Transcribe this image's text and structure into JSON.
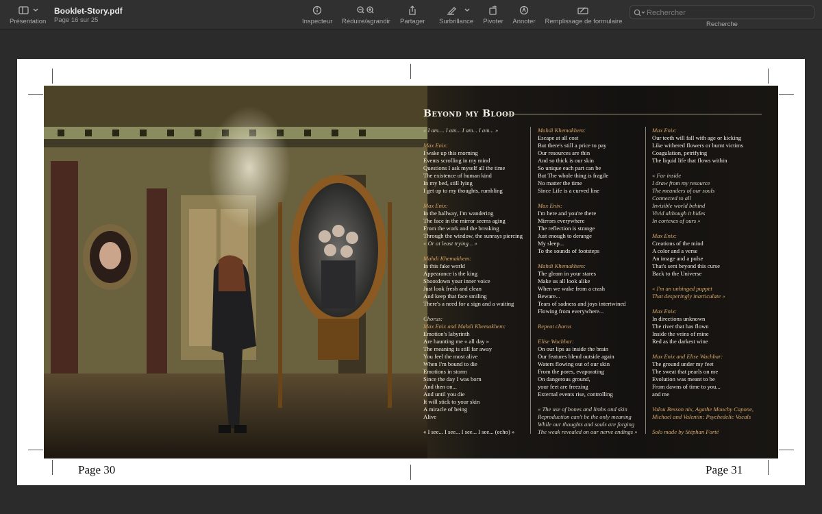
{
  "toolbar": {
    "view_label": "Présentation",
    "document_title": "Booklet-Story.pdf",
    "page_indicator": "Page 16 sur 25",
    "inspector_label": "Inspecteur",
    "zoom_label": "Réduire/agrandir",
    "share_label": "Partager",
    "highlight_label": "Surbrillance",
    "rotate_label": "Pivoter",
    "annotate_label": "Annoter",
    "form_label": "Remplissage de formulaire",
    "search_placeholder": "Rechercher",
    "search_label": "Recherche"
  },
  "booklet": {
    "left_page_number": "Page 30",
    "right_page_number": "Page 31",
    "song_title": "Beyond my Blood",
    "columns": [
      [
        {
          "t": "« I am.... I am... I am... I am... »",
          "s": "it"
        },
        {
          "gap": true
        },
        {
          "t": "Max Enix:",
          "s": "spk"
        },
        {
          "t": "I wake up this morning"
        },
        {
          "t": "Events scrolling in my mind"
        },
        {
          "t": "Questions I ask myself all the time"
        },
        {
          "t": "The existence of human kind"
        },
        {
          "t": "In my bed, still lying"
        },
        {
          "t": "I get up to my thoughts, rumbling"
        },
        {
          "gap": true
        },
        {
          "t": "Max Enix:",
          "s": "spk"
        },
        {
          "t": "In the hallway, I'm wandering"
        },
        {
          "t": "The face in the mirror seems aging"
        },
        {
          "t": "From the work and the breaking"
        },
        {
          "t": "Through the window, the sunrays piercing"
        },
        {
          "t": "« Or at least trying... »",
          "s": "it"
        },
        {
          "gap": true
        },
        {
          "t": "Mahdi Khemakhem:",
          "s": "spk"
        },
        {
          "t": "In this fake world"
        },
        {
          "t": "Appearance is the king"
        },
        {
          "t": "Shootdown your inner voice"
        },
        {
          "t": "Just look fresh and clean"
        },
        {
          "t": "And keep that face smiling"
        },
        {
          "t": "There's a need for a sign and a waiting"
        },
        {
          "gap": true
        },
        {
          "t": "Chorus:",
          "s": "it"
        },
        {
          "t": "Max Enix and Mahdi Khemakhem:",
          "s": "spk"
        },
        {
          "t": "Emotion's labyrinth"
        },
        {
          "t": "Are haunting me « all day »"
        },
        {
          "t": "The meaning is still far away"
        },
        {
          "t": "You feel the most alive"
        },
        {
          "t": "When I'm bound to die"
        },
        {
          "t": "Emotions in storm"
        },
        {
          "t": "Since the day I was born"
        },
        {
          "t": "And then on..."
        },
        {
          "t": "And until you die"
        },
        {
          "t": "It will stick to your skin"
        },
        {
          "t": "A miracle of being"
        },
        {
          "t": "Alive"
        },
        {
          "gap": true
        },
        {
          "t": "« I see... I see... I see... I see... (echo) »"
        }
      ],
      [
        {
          "t": "Mahdi Khemakhem:",
          "s": "spk"
        },
        {
          "t": "Escape at all cost"
        },
        {
          "t": "But there's still a price to pay"
        },
        {
          "t": "Our resources are thin"
        },
        {
          "t": "And so thick is our skin"
        },
        {
          "t": "So unique each part can be"
        },
        {
          "t": "But The whole thing is fragile"
        },
        {
          "t": "No matter the time"
        },
        {
          "t": "Since Life is a curved line"
        },
        {
          "gap": true
        },
        {
          "t": "Max Enix:",
          "s": "spk"
        },
        {
          "t": "I'm here and you're there"
        },
        {
          "t": "Mirrors everywhere"
        },
        {
          "t": "The reflection is strange"
        },
        {
          "t": "Just enough to derange"
        },
        {
          "t": " My sleep..."
        },
        {
          "t": "To the sounds of footsteps"
        },
        {
          "gap": true
        },
        {
          "t": "Mahdi Khemakhem:",
          "s": "spk"
        },
        {
          "t": "The gleam in your stares"
        },
        {
          "t": "Make us all look alike"
        },
        {
          "t": "When we wake from a crash"
        },
        {
          "t": "Beware..."
        },
        {
          "t": "Tears of sadness and joys intertwined"
        },
        {
          "t": "Flowing from everywhere..."
        },
        {
          "gap": true
        },
        {
          "t": "Repeat chorus",
          "s": "spk"
        },
        {
          "gap": true
        },
        {
          "t": "Elise Wachbar:",
          "s": "spk"
        },
        {
          "t": "On our lips as inside the brain"
        },
        {
          "t": "Our features blend outside again"
        },
        {
          "t": "Waters flowing out of our skin"
        },
        {
          "t": "From the pores, evaporating"
        },
        {
          "t": "On dangerous ground,"
        },
        {
          "t": "your feet are freezing"
        },
        {
          "t": "External events rise, controlling"
        },
        {
          "gap": true
        },
        {
          "t": "« The use of bones and limbs and skin",
          "s": "it"
        },
        {
          "t": "Reproduction can't be the only meaning",
          "s": "it"
        },
        {
          "t": "While our thoughts and souls are forging",
          "s": "it"
        },
        {
          "t": "The weak revealed on our nerve endings »",
          "s": "it"
        }
      ],
      [
        {
          "t": "Max Enix:",
          "s": "spk"
        },
        {
          "t": "Our teeth will fall with age or kicking"
        },
        {
          "t": "Like withered flowers or burnt victims"
        },
        {
          "t": "Coagulation, petrifying"
        },
        {
          "t": "The liquid life that flows within"
        },
        {
          "gap": true
        },
        {
          "t": "« Far inside",
          "s": "it"
        },
        {
          "t": "I draw from my resource",
          "s": "it"
        },
        {
          "t": "The meanders of our souls",
          "s": "it"
        },
        {
          "t": "Connected to all",
          "s": "it"
        },
        {
          "t": "Invisible world behind",
          "s": "it"
        },
        {
          "t": "Vivid although it hides",
          "s": "it"
        },
        {
          "t": "In cortexes of ours »",
          "s": "it"
        },
        {
          "gap": true
        },
        {
          "t": "Max Enix:",
          "s": "spk"
        },
        {
          "t": "Creations of the mind"
        },
        {
          "t": "A color and a verse"
        },
        {
          "t": "An image and a pulse"
        },
        {
          "t": "That's sent beyond this curse"
        },
        {
          "t": "Back to the Universe"
        },
        {
          "gap": true
        },
        {
          "t": "« I'm an unhinged puppet",
          "s": "cr"
        },
        {
          "t": "That desperingly inarticulate »",
          "s": "cr"
        },
        {
          "gap": true
        },
        {
          "t": "Max Enix:",
          "s": "spk"
        },
        {
          "t": "In directions unknown"
        },
        {
          "t": "The river that has flown"
        },
        {
          "t": "Inside the veins of mine"
        },
        {
          "t": "Red as the darkest wine"
        },
        {
          "gap": true
        },
        {
          "t": "Max Enix and Elise Wachbar:",
          "s": "spk"
        },
        {
          "t": "The ground under my feet"
        },
        {
          "t": "The sweat that pearls on me"
        },
        {
          "t": "Evolution was meant to be"
        },
        {
          "t": "From dawns of time to you..."
        },
        {
          "t": "and me"
        },
        {
          "gap": true
        },
        {
          "t": "Valou Besson nix, Agathe Mouchy Capone,",
          "s": "cr"
        },
        {
          "t": "Michael and Valentin: Psychedelic Vocals",
          "s": "cr"
        },
        {
          "gap": true
        },
        {
          "t": "Solo made by Stéphan Forté",
          "s": "cr"
        }
      ]
    ]
  },
  "colors": {
    "toolbar_bg": "#303030",
    "window_bg": "#2b2b2b",
    "speaker_gold": "#d9a96a",
    "lyric_text": "#f4f0e6"
  }
}
